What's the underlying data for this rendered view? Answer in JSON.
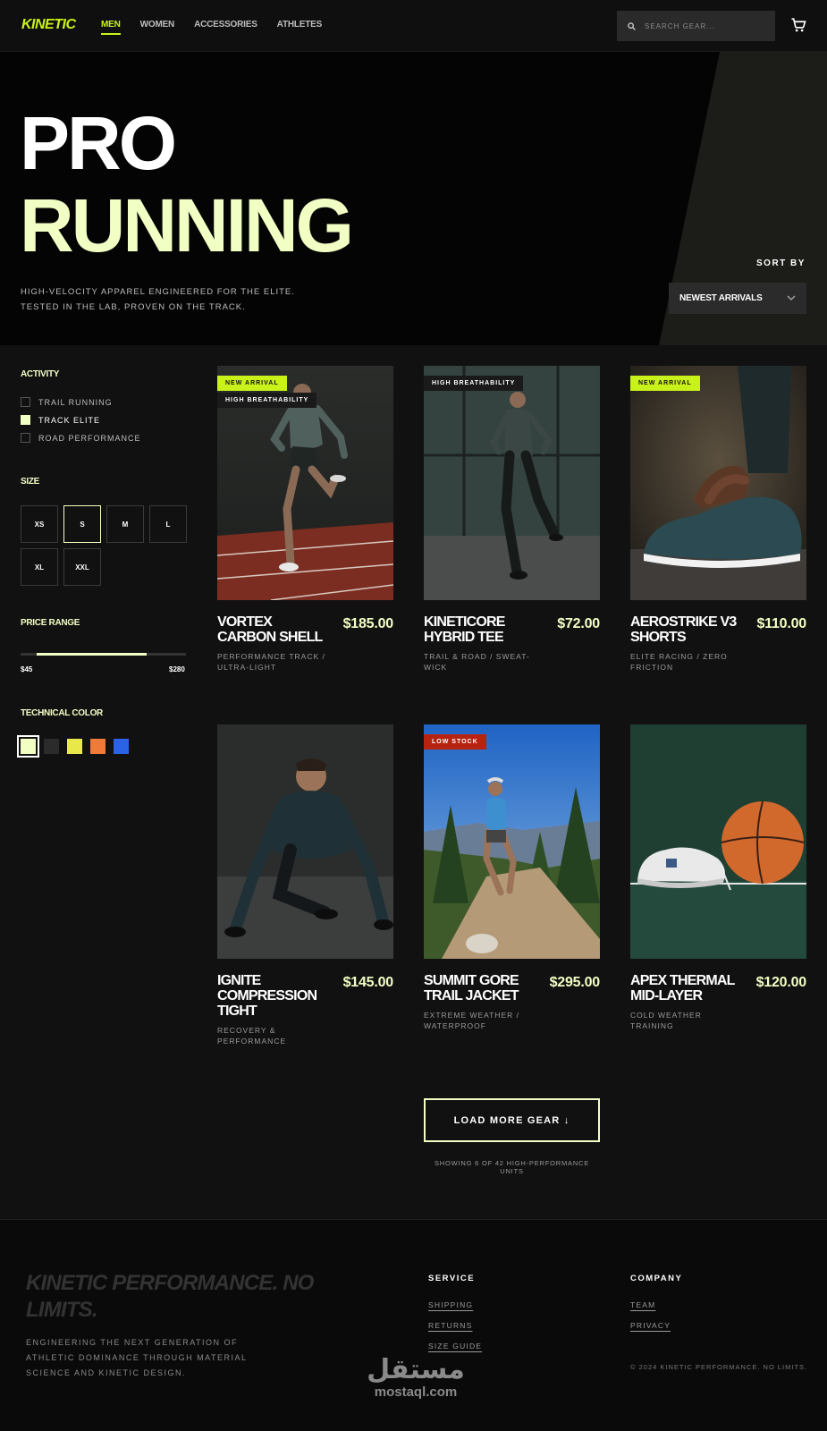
{
  "header": {
    "logo": "KINETIC",
    "nav": [
      {
        "label": "MEN",
        "active": true
      },
      {
        "label": "WOMEN",
        "active": false
      },
      {
        "label": "ACCESSORIES",
        "active": false
      },
      {
        "label": "ATHLETES",
        "active": false
      }
    ],
    "search_placeholder": "SEARCH GEAR...",
    "icons": {
      "search": "search-icon",
      "cart": "cart-icon"
    }
  },
  "hero": {
    "title_line1": "PRO",
    "title_line2": "RUNNING",
    "subtitle_line1": "HIGH-VELOCITY APPAREL ENGINEERED FOR THE ELITE.",
    "subtitle_line2": "TESTED IN THE LAB, PROVEN ON THE TRACK.",
    "sort_label": "SORT BY",
    "sort_value": "NEWEST ARRIVALS"
  },
  "filters": {
    "activity": {
      "heading": "ACTIVITY",
      "options": [
        {
          "label": "TRAIL RUNNING",
          "checked": false
        },
        {
          "label": "TRACK ELITE",
          "checked": true
        },
        {
          "label": "ROAD PERFORMANCE",
          "checked": false
        }
      ]
    },
    "size": {
      "heading": "SIZE",
      "options": [
        "XS",
        "S",
        "M",
        "L",
        "XL",
        "XXL"
      ],
      "selected": "S"
    },
    "price": {
      "heading": "PRICE RANGE",
      "min_label": "$45",
      "max_label": "$280",
      "selected_range_fraction": [
        0.1,
        0.74
      ]
    },
    "color": {
      "heading": "TECHNICAL COLOR",
      "swatches": [
        "#f2ffc4",
        "#2b2b2b",
        "#e8e84a",
        "#f07a3a",
        "#2b63e6"
      ],
      "selected_index": 0
    }
  },
  "products": [
    {
      "name": "VORTEX CARBON SHELL",
      "price": "$185.00",
      "category": "PERFORMANCE TRACK / ULTRA-LIGHT",
      "badges": [
        "NEW ARRIVAL",
        "HIGH BREATHABILITY"
      ],
      "image": "runner-on-track"
    },
    {
      "name": "KINETICORE HYBRID TEE",
      "price": "$72.00",
      "category": "TRAIL & ROAD / SWEAT-WICK",
      "badges": [
        "HIGH BREATHABILITY"
      ],
      "image": "runner-indoor"
    },
    {
      "name": "AEROSTRIKE V3 SHORTS",
      "price": "$110.00",
      "category": "ELITE RACING / ZERO FRICTION",
      "badges": [
        "NEW ARRIVAL"
      ],
      "image": "lacing-shoe"
    },
    {
      "name": "IGNITE COMPRESSION TIGHT",
      "price": "$145.00",
      "category": "RECOVERY & PERFORMANCE",
      "badges": [],
      "image": "athlete-crouch"
    },
    {
      "name": "SUMMIT GORE TRAIL JACKET",
      "price": "$295.00",
      "category": "EXTREME WEATHER / WATERPROOF",
      "badges": [
        "LOW STOCK"
      ],
      "image": "trail-runner"
    },
    {
      "name": "APEX THERMAL MID-LAYER",
      "price": "$120.00",
      "category": "COLD WEATHER TRAINING",
      "badges": [],
      "image": "shoe-and-ball"
    }
  ],
  "load_more": "LOAD MORE GEAR ↓",
  "showing_text": "SHOWING 6 OF 42 HIGH-PERFORMANCE UNITS",
  "footer": {
    "tagline": "KINETIC PERFORMANCE. NO LIMITS.",
    "description": "ENGINEERING THE NEXT GENERATION OF ATHLETIC DOMINANCE THROUGH MATERIAL SCIENCE AND KINETIC DESIGN.",
    "service": {
      "heading": "SERVICE",
      "links": [
        "SHIPPING",
        "RETURNS",
        "SIZE GUIDE"
      ]
    },
    "company": {
      "heading": "COMPANY",
      "links": [
        "TEAM",
        "PRIVACY"
      ]
    },
    "copyright": "© 2024 KINETIC PERFORMANCE. NO LIMITS.",
    "watermark_ar": "مستقل",
    "watermark_en": "mostaql.com"
  }
}
